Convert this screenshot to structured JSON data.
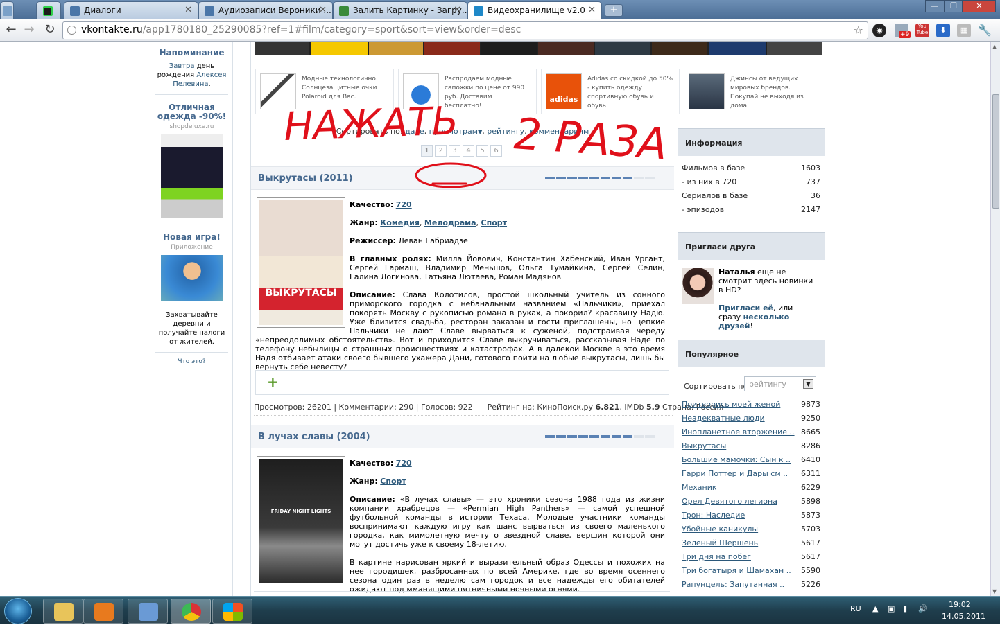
{
  "browser": {
    "tabs": [
      {
        "label": "Диалоги",
        "color": "#4a76a8"
      },
      {
        "label": "Аудиозаписи Вероники ...",
        "color": "#4a76a8"
      },
      {
        "label": "Залить Картинку - Загру...",
        "color": "#3a8a3a"
      },
      {
        "label": "Видеохранилище v2.0",
        "color": "#1e88c8"
      }
    ],
    "new_tab": "+",
    "url_host": "vkontakte.ru",
    "url_path": "/app1780180_25290085?ref=1#film/category=sport&sort=view&order=desc",
    "badge": "+9",
    "youtube": "You Tube"
  },
  "left": {
    "reminder_title": "Напоминание",
    "reminder_link1": "Завтра",
    "reminder_text": "день рождения",
    "reminder_link2": "Алексея Пелевина",
    "reminder_end": ".",
    "ad1_title": "Отличная одежда -90%!",
    "ad1_site": "shopdeluxe.ru",
    "ad2_title": "Новая игра!",
    "ad2_sub": "Приложение",
    "ad2_text": "Захватывайте деревни и получайте налоги от жителей.",
    "what": "Что это?"
  },
  "ads": [
    {
      "text": "Модные технологично. Солнцезащитные очки Polaroid для Вас."
    },
    {
      "text": "Распродаем модные сапожки по цене от 990 руб. Доставим бесплатно!"
    },
    {
      "text": "Adidas со скидкой до 50% - купить одежду спортивную обувь и обувь"
    },
    {
      "text": "Джинсы от ведущих мировых брендов. Покупай не выходя из дома"
    }
  ],
  "sort": {
    "label": "Сортировать по:",
    "date": "дате",
    "views": "просмотрам",
    "rating": "рейтингу",
    "comments": "комментариям",
    "sep": ","
  },
  "pages": [
    "1",
    "2",
    "3",
    "4",
    "5",
    "6"
  ],
  "films": [
    {
      "title": "Выкрутасы (2011)",
      "rating_filled": 8,
      "quality_label": "Качество:",
      "quality": "720",
      "genre_label": "Жанр:",
      "genres": [
        "Комедия",
        "Мелодрама",
        "Спорт"
      ],
      "director_label": "Режиссер:",
      "director": "Леван Габриадзе",
      "cast_label": "В главных ролях:",
      "cast": "Милла Йовович, Константин Хабенский, Иван Ургант, Сергей Гармаш, Владимир Меньшов, Ольга Тумайкина, Сергей Селин, Галина Логинова, Татьяна Лютаева, Роман Мадянов",
      "desc_label": "Описание:",
      "desc": "Слава Колотилов, простой школьный учитель из сонного приморского городка с небанальным названием «Пальчики», приехал покорять Москву с рукописью романа в руках, а покорил? красавицу Надю. Уже близится свадьба, ресторан заказан и гости приглашены, но цепкие Пальчики не дают Славе вырваться к суженой, подстраивая череду «непреодолимых обстоятельств». Вот и приходится Славе выкручиваться, рассказывая Наде по телефону небылицы о страшных происшествиях и катастрофах. А в далёкой Москве в это время Надя отбивает атаки своего бывшего ухажера Дани, готового пойти на любые выкрутасы, лишь бы вернуть себе невесту?",
      "poster_title": "ВЫКРУТАСЫ",
      "stats": "Просмотров: 26201 | Комментарии: 290 | Голосов: 922",
      "rating_label": "Рейтинг на: КиноПоиск.ру",
      "kp": "6.821",
      "imdb_label": "IMDb",
      "imdb": "5.9",
      "country": "Страна: Россия",
      "add": "+"
    },
    {
      "title": "В лучах славы (2004)",
      "rating_filled": 8,
      "quality_label": "Качество:",
      "quality": "720",
      "genre_label": "Жанр:",
      "genres": [
        "Спорт"
      ],
      "desc_label": "Описание:",
      "desc": "«В лучах славы» — это хроники сезона 1988 года из жизни компании храбрецов — «Permian High Panthers» — самой успешной футбольной команды в истории Техаса. Молодые участники команды воспринимают каждую игру как шанс вырваться из своего маленького городка, как мимолетную мечту о звездной славе, вершин которой они могут достичь уже к своему 18-летию.",
      "desc2": "В картине нарисован яркий и выразительный образ Одессы и похожих на нее городишек, разбросанных по всей Америке, где во время осеннего сезона один раз в неделю сам городок и все надежды его обитателей ожидают под мманящими пятничными ночными огнями.",
      "poster_title": "FRIDAY NIGHT LIGHTS"
    }
  ],
  "info": {
    "title": "Информация",
    "rows": [
      {
        "label": "Фильмов в базе",
        "value": "1603"
      },
      {
        "label": "- из них в 720",
        "value": "737"
      },
      {
        "label": "Сериалов в базе",
        "value": "36"
      },
      {
        "label": "- эпизодов",
        "value": "2147"
      }
    ]
  },
  "invite": {
    "title": "Пригласи друга",
    "name": "Наталья",
    "text1": "еще не смотрит здесь новинки в HD?",
    "link1": "Пригласи её",
    "text2": ", или сразу",
    "link2": "несколько друзей",
    "end": "!"
  },
  "popular": {
    "title": "Популярное",
    "sort_label": "Сортировать по",
    "sort_value": "рейтингу",
    "items": [
      {
        "name": "Притворись моей женой",
        "value": "9873"
      },
      {
        "name": "Неадекватные люди",
        "value": "9250"
      },
      {
        "name": "Инопланетное вторжение ..",
        "value": "8665"
      },
      {
        "name": "Выкрутасы",
        "value": "8286"
      },
      {
        "name": "Большие мамочки: Сын к ..",
        "value": "6410"
      },
      {
        "name": "Гарри Поттер и Дары см ..",
        "value": "6311"
      },
      {
        "name": "Механик",
        "value": "6229"
      },
      {
        "name": "Орел Девятого легиона",
        "value": "5898"
      },
      {
        "name": "Трон: Наследие",
        "value": "5873"
      },
      {
        "name": "Убойные каникулы",
        "value": "5703"
      },
      {
        "name": "Зелёный Шершень",
        "value": "5617"
      },
      {
        "name": "Три дня на побег",
        "value": "5617"
      },
      {
        "name": "Три богатыря и Шамахан ..",
        "value": "5590"
      },
      {
        "name": "Рапунцель: Запутанная ..",
        "value": "5226"
      }
    ]
  },
  "annotation": {
    "line1": "НАЖАТЬ",
    "line2": "2 РАЗА",
    "color": "#e0101a"
  },
  "taskbar": {
    "lang": "RU",
    "time": "19:02",
    "date": "14.05.2011"
  }
}
